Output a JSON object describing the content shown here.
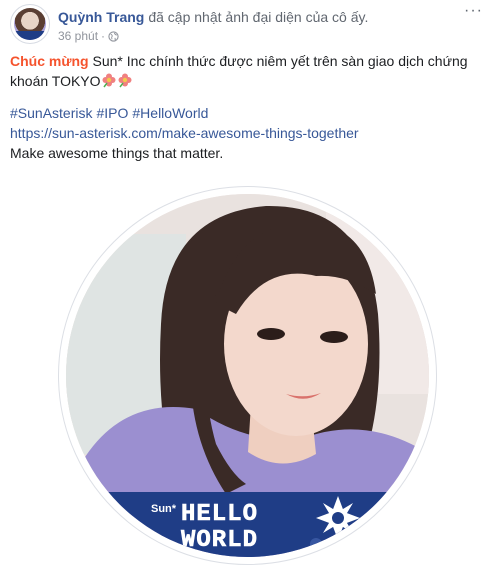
{
  "post": {
    "author": "Quỳnh Trang",
    "action": "đã cập nhật ảnh đại diện của cô ấy.",
    "time": "36 phút",
    "separator": "·",
    "more": "···",
    "congrats_word": "Chúc mừng",
    "text_rest": "Sun* Inc chính thức được niêm yết trên sàn giao dịch chứng khoán TOKYO",
    "hashtags": [
      "#SunAsterisk",
      "#IPO",
      "#HelloWorld"
    ],
    "link": "https://sun-asterisk.com/make-awesome-things-together",
    "tagline": "Make awesome things that matter."
  },
  "frame": {
    "brand": "Sun*",
    "line1": "HELLO",
    "line2": "WORLD"
  },
  "colors": {
    "author": "#385898",
    "congrats": "#f5532d",
    "band": "#1f3d86",
    "shirt": "#9b8fd0"
  },
  "icons": {
    "privacy": "globe-icon",
    "more": "more-options-icon",
    "emoji": "flower-emoji"
  }
}
